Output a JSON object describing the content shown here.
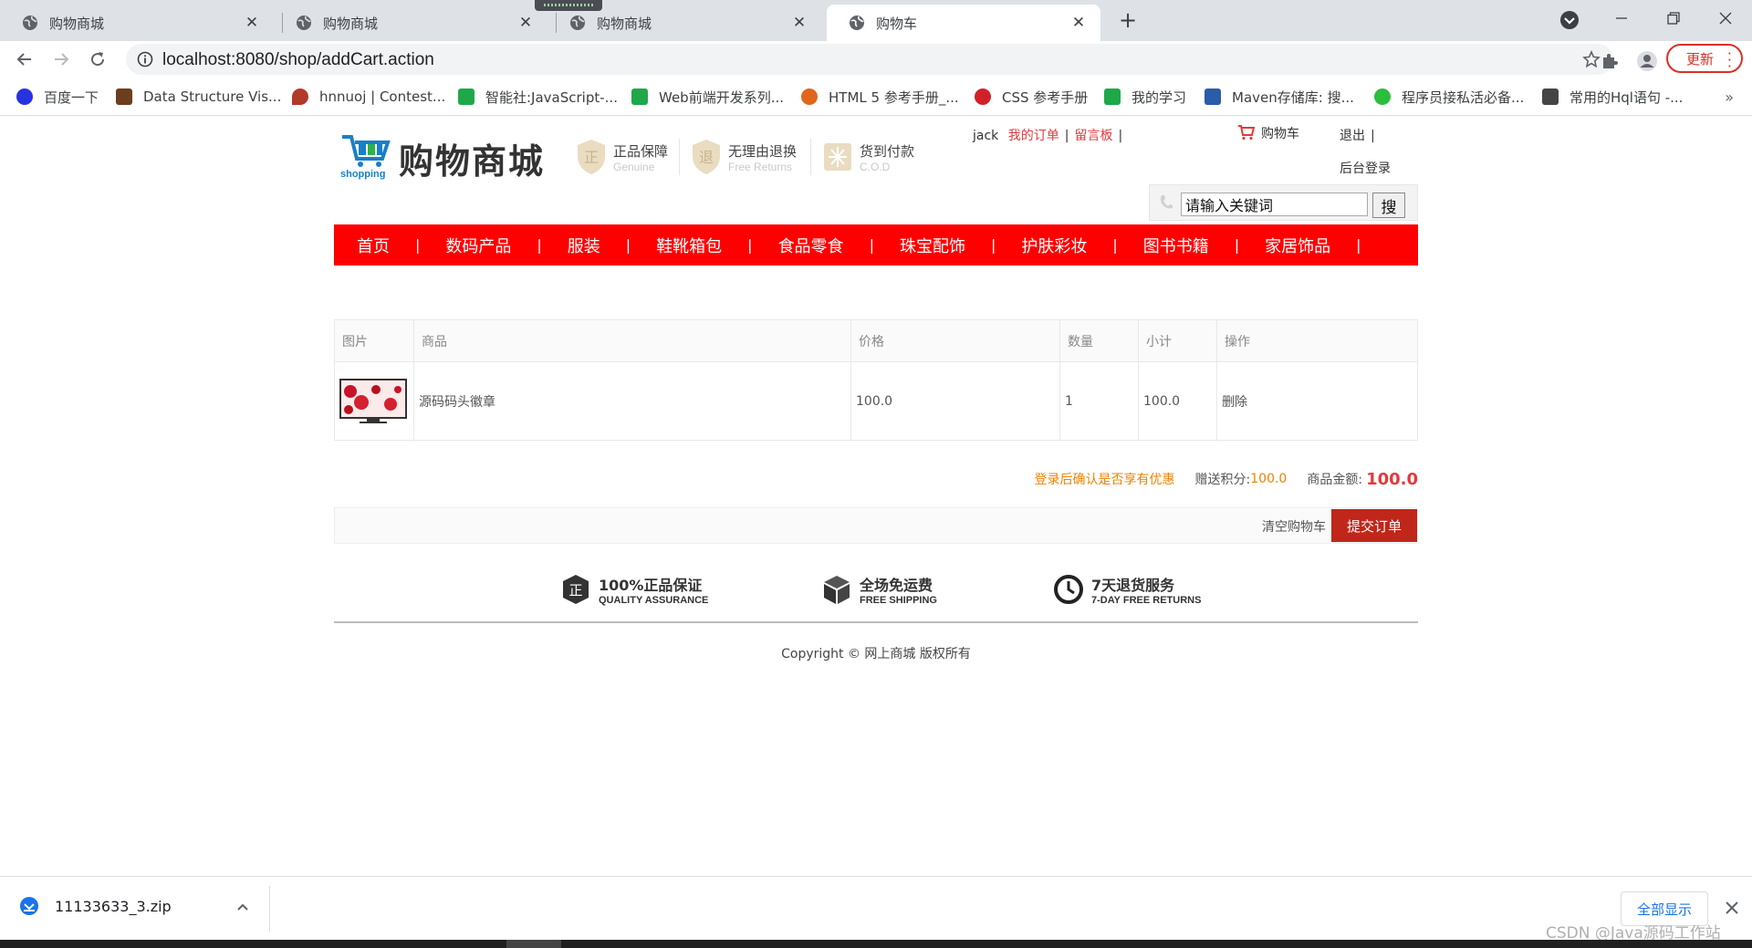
{
  "browser": {
    "tabs": [
      {
        "title": "购物商城",
        "active": false
      },
      {
        "title": "购物商城",
        "active": false
      },
      {
        "title": "购物商城",
        "active": false
      },
      {
        "title": "购物车",
        "active": true
      }
    ],
    "url": "localhost:8080/shop/addCart.action",
    "update_label": "更新",
    "bookmarks": [
      {
        "label": "百度一下",
        "icon": "baidu-paw-icon",
        "color": "#2932e1"
      },
      {
        "label": "Data Structure Vis...",
        "icon": "data-structure-icon",
        "color": "#6b3e1e"
      },
      {
        "label": "hnnuoj | Contest...",
        "icon": "pin-icon",
        "color": "#b23a2b"
      },
      {
        "label": "智能社:JavaScript-...",
        "icon": "bookmark-green-icon",
        "color": "#1ea84a"
      },
      {
        "label": "Web前端开发系列...",
        "icon": "bookmark-green-icon",
        "color": "#1ea84a"
      },
      {
        "label": "HTML 5 参考手册_...",
        "icon": "w3school-icon",
        "color": "#e0661a"
      },
      {
        "label": "CSS 参考手册",
        "icon": "css-icon",
        "color": "#d0212b"
      },
      {
        "label": "我的学习",
        "icon": "bookmark-green-icon",
        "color": "#1ea84a"
      },
      {
        "label": "Maven存储库: 搜...",
        "icon": "maven-icon",
        "color": "#2b5ca8"
      },
      {
        "label": "程序员接私活必备...",
        "icon": "wechat-icon",
        "color": "#2bbd3c"
      },
      {
        "label": "常用的Hql语句 -...",
        "icon": "csdn-icon",
        "color": "#444444"
      }
    ]
  },
  "header": {
    "logo_text": "购物商城",
    "logo_sub": "shopping",
    "promises": [
      {
        "cn": "正品保障",
        "en": "Genuine"
      },
      {
        "cn": "无理由退换",
        "en": "Free Returns"
      },
      {
        "cn": "货到付款",
        "en": "C.O.D"
      }
    ],
    "user": {
      "name": "jack",
      "my_orders": "我的订单",
      "message_board": "留言板",
      "cart": "购物车",
      "logout": "退出",
      "admin_login": "后台登录",
      "pipe": "|"
    },
    "search": {
      "value": "请输入关键词",
      "button": "搜"
    }
  },
  "categories": [
    "首页",
    "数码产品",
    "服装",
    "鞋靴箱包",
    "食品零食",
    "珠宝配饰",
    "护肤彩妆",
    "图书书籍",
    "家居饰品"
  ],
  "cart": {
    "columns": [
      "图片",
      "商品",
      "价格",
      "数量",
      "小计",
      "操作"
    ],
    "rows": [
      {
        "name": "源码码头徽章",
        "price": "100.0",
        "qty": "1",
        "subtotal": "100.0",
        "action": "删除"
      }
    ],
    "login_hint": "登录后确认是否享有优惠",
    "points_label": "赠送积分:",
    "points": "100.0",
    "amount_label": "商品金额:",
    "amount": "100.0",
    "clear_label": "清空购物车",
    "submit_label": "提交订单"
  },
  "services": [
    {
      "cn": "100%正品保证",
      "en": "QUALITY ASSURANCE"
    },
    {
      "cn": "全场免运费",
      "en": "FREE SHIPPING"
    },
    {
      "cn": "7天退货服务",
      "en": "7-DAY FREE RETURNS"
    }
  ],
  "footer": {
    "copyright": "Copyright © 网上商城 版权所有"
  },
  "download": {
    "file": "11133633_3.zip",
    "show_all": "全部显示"
  },
  "watermark": "CSDN @Java源码工作站",
  "colors": {
    "nav_red": "#ff0000",
    "accent_red": "#e4393c",
    "submit_red": "#c1261a",
    "orange": "#f08200",
    "link_blue": "#1a73e8"
  }
}
